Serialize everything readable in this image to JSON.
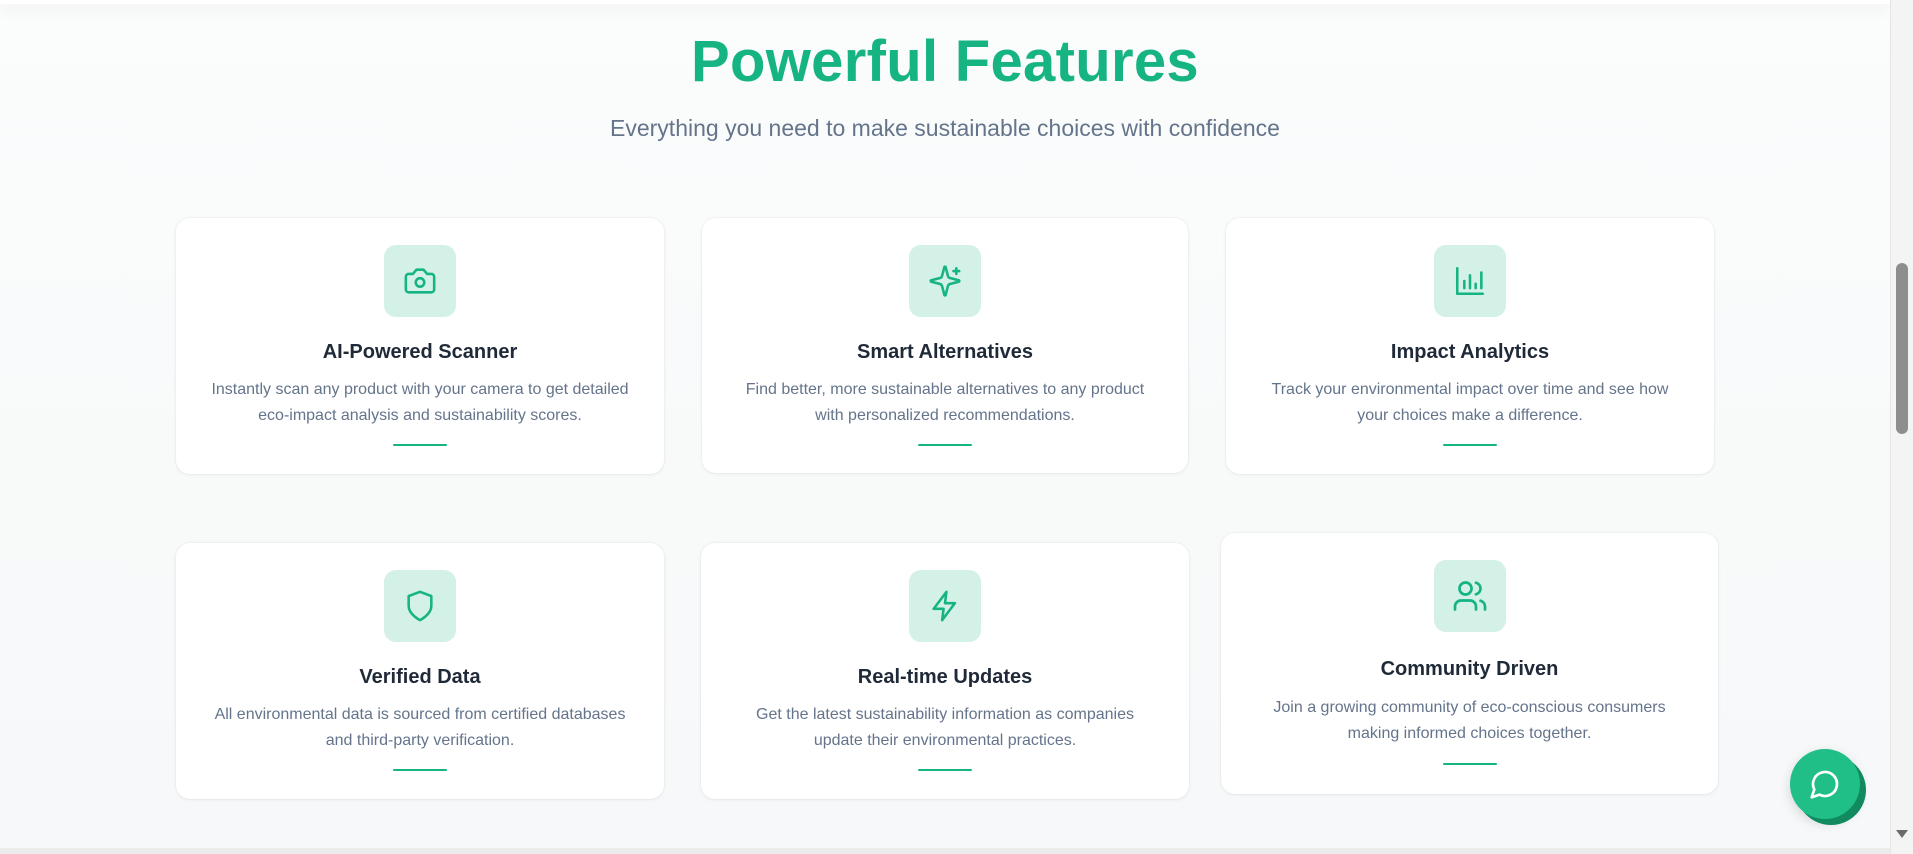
{
  "header": {
    "title": "Powerful Features",
    "subtitle": "Everything you need to make sustainable choices with confidence"
  },
  "features": [
    {
      "icon": "camera-icon",
      "title": "AI-Powered Scanner",
      "description": "Instantly scan any product with your camera to get detailed eco-impact analysis and sustainability scores."
    },
    {
      "icon": "sparkles-icon",
      "title": "Smart Alternatives",
      "description": "Find better, more sustainable alternatives to any product with personalized recommendations."
    },
    {
      "icon": "bar-chart-icon",
      "title": "Impact Analytics",
      "description": "Track your environmental impact over time and see how your choices make a difference."
    },
    {
      "icon": "shield-icon",
      "title": "Verified Data",
      "description": "All environmental data is sourced from certified databases and third-party verification."
    },
    {
      "icon": "lightning-bolt-icon",
      "title": "Real-time Updates",
      "description": "Get the latest sustainability information as companies update their environmental practices."
    },
    {
      "icon": "users-icon",
      "title": "Community Driven",
      "description": "Join a growing community of eco-conscious consumers making informed choices together."
    }
  ],
  "chat": {
    "icon": "chat-bubble-icon"
  },
  "colors": {
    "accent": "#16b383",
    "icon_bg": "#d3f1e7",
    "text_dark": "#1f2937",
    "text_muted": "#64748b"
  }
}
